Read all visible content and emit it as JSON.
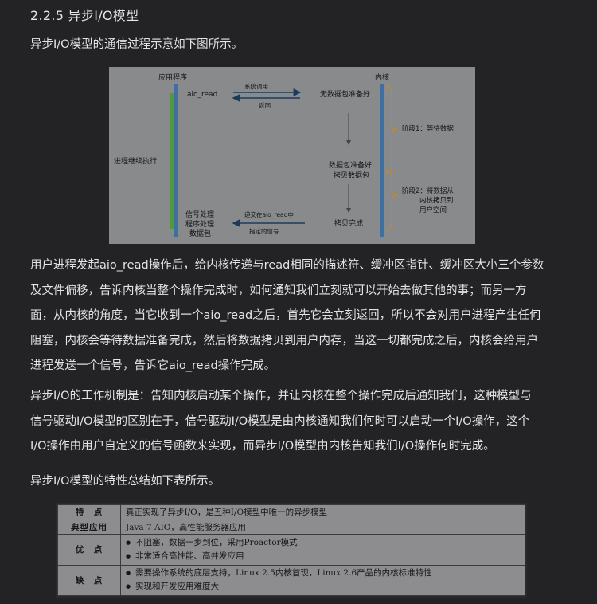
{
  "heading": "2.2.5 异步I/O模型",
  "intro": "异步I/O模型的通信过程示意如下图所示。",
  "diagram": {
    "app_label": "应用程序",
    "kernel_label": "内核",
    "aio_read": "aio_read",
    "syscall": "系统调用",
    "return": "返回",
    "no_data": "无数据包准备好",
    "continue_exec": "进程继续执行",
    "data_ready": "数据包准备好",
    "copy_data": "拷贝数据包",
    "copy_done": "拷贝完成",
    "stage1": "阶段1：等待数据",
    "stage2_line1": "阶段2：将数据从",
    "stage2_line2": "内核拷贝到",
    "stage2_line3": "用户空间",
    "signal_line1": "信号处理",
    "signal_line2": "程序处理",
    "signal_line3": "数据包",
    "deliver": "递交在aio_read中",
    "specified_signal": "指定的信号"
  },
  "paragraph1": [
    "用户进程发起aio_read操作后，给内核传递与read相同的描述符、缓冲区指针、缓冲区大小三个参数",
    "及文件偏移，告诉内核当整个操作完成时，如何通知我们立刻就可以开始去做其他的事；而另一方",
    "面，从内核的角度，当它收到一个aio_read之后，首先它会立刻返回，所以不会对用户进程产生任何",
    "阻塞，内核会等待数据准备完成，然后将数据拷贝到用户内存，当这一切都完成之后，内核会给用户",
    "进程发送一个信号，告诉它aio_read操作完成。"
  ],
  "paragraph2": [
    "异步I/O的工作机制是：告知内核启动某个操作，并让内核在整个操作完成后通知我们，这种模型与",
    "信号驱动I/O模型的区别在于，信号驱动I/O模型是由内核通知我们何时可以启动一个I/O操作，这个",
    "I/O操作由用户自定义的信号函数来实现，而异步I/O模型由内核告知我们I/O操作何时完成。"
  ],
  "summary_intro": "异步I/O模型的特性总结如下表所示。",
  "table": {
    "rows": [
      {
        "label": "特　点",
        "value": "真正实现了异步I/O，是五种I/O模型中唯一的异步模型"
      },
      {
        "label": "典型应用",
        "value": "Java 7 AIO，高性能服务器应用"
      },
      {
        "label": "优　点",
        "bullets": [
          "不阻塞，数据一步到位，采用Proactor模式",
          "非常适合高性能、高并发应用"
        ]
      },
      {
        "label": "缺　点",
        "bullets": [
          "需要操作系统的底层支持，Linux 2.5内核首现，Linux 2.6产品的内核标准特性",
          "实现和开发应用难度大"
        ]
      }
    ]
  },
  "colors": {
    "background": "#232326",
    "diagram_bg": "#898a8c",
    "app_bar": "#3f6fa0",
    "green_bar": "#4f9a3c",
    "bracket": "#c08a2c"
  }
}
